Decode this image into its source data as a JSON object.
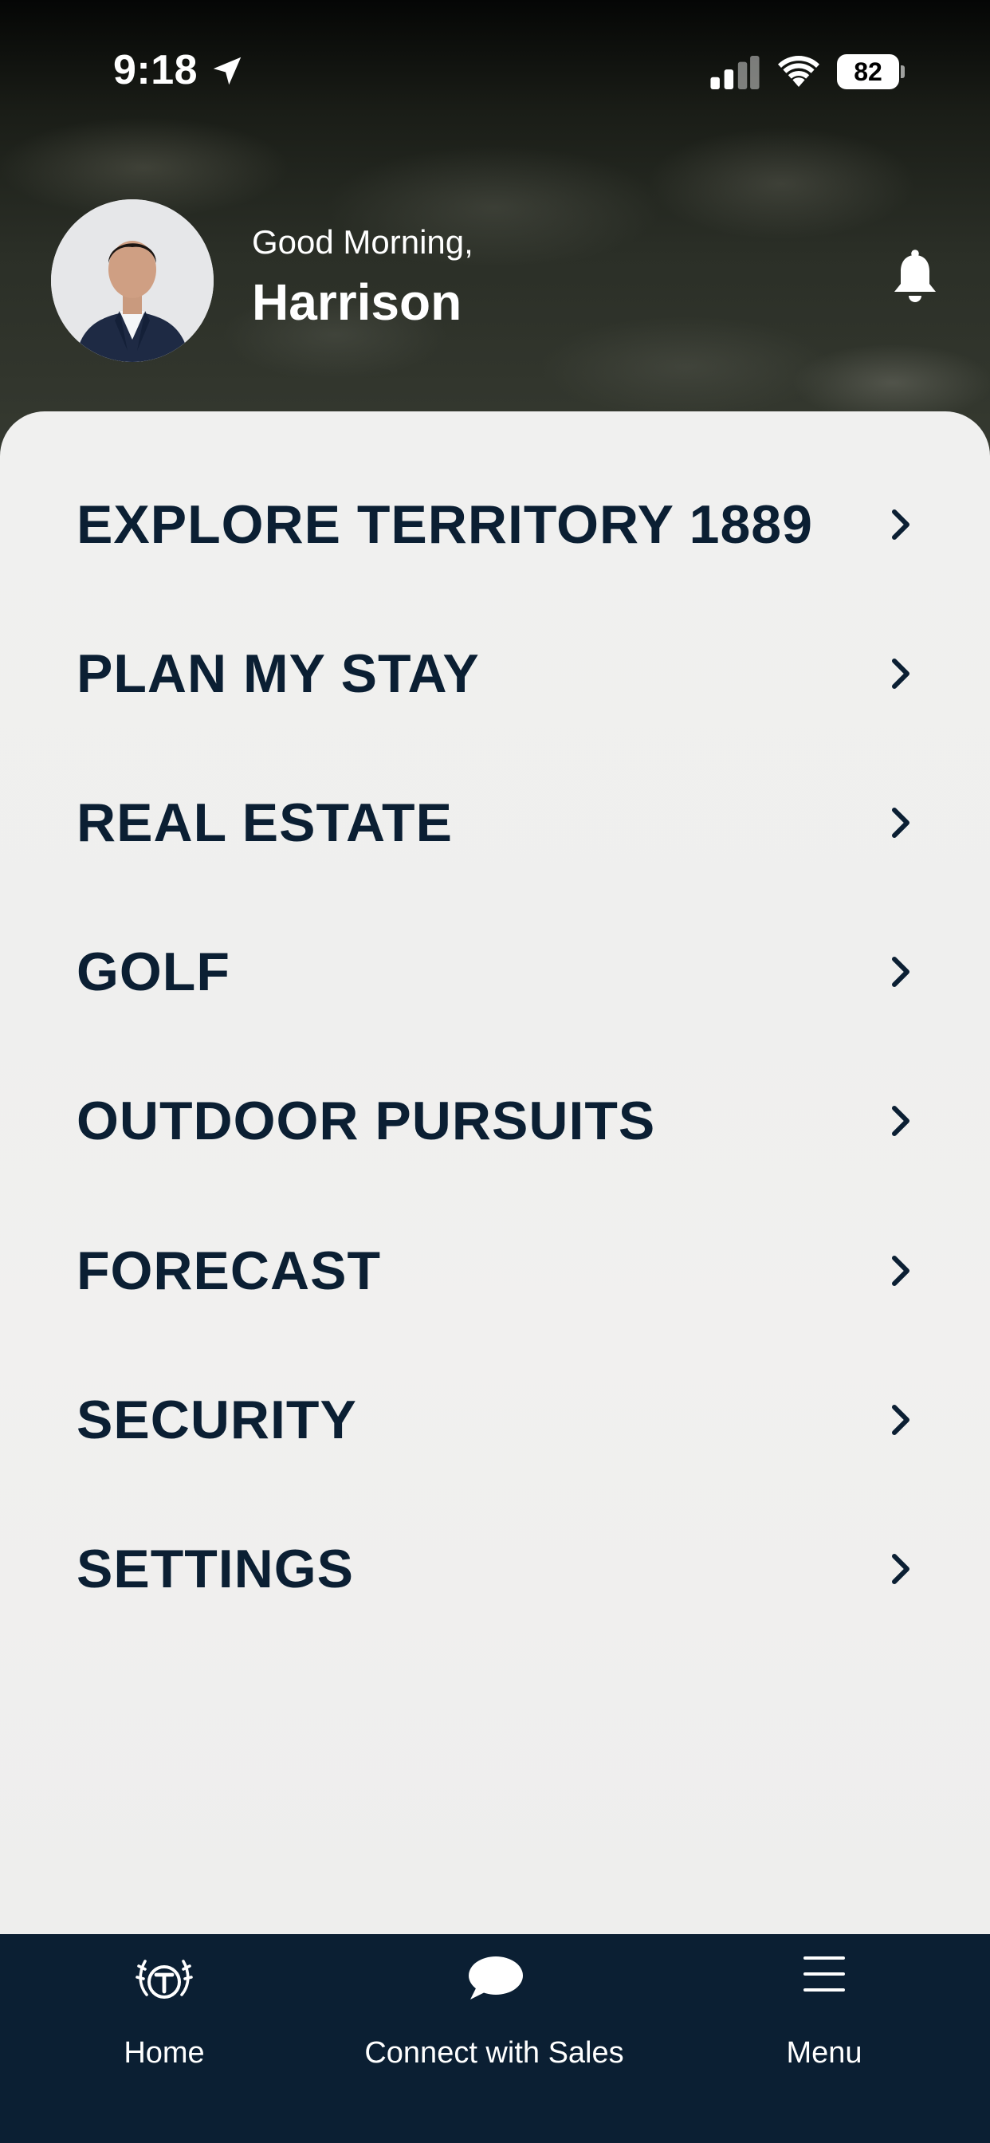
{
  "status_bar": {
    "time": "9:18",
    "battery_level": "82"
  },
  "header": {
    "greeting": "Good Morning,",
    "user_name": "Harrison"
  },
  "menu": {
    "items": [
      {
        "label": "EXPLORE TERRITORY 1889"
      },
      {
        "label": "PLAN MY STAY"
      },
      {
        "label": "REAL ESTATE"
      },
      {
        "label": "GOLF"
      },
      {
        "label": "OUTDOOR PURSUITS"
      },
      {
        "label": "FORECAST"
      },
      {
        "label": "SECURITY"
      },
      {
        "label": "SETTINGS"
      }
    ]
  },
  "tab_bar": {
    "home_label": "Home",
    "sales_label": "Connect with Sales",
    "menu_label": "Menu"
  },
  "colors": {
    "navy": "#0b1f33",
    "card_background": "#f0f0ef",
    "header_text": "#ffffff"
  },
  "icons": {
    "location": "location-arrow-icon",
    "signal": "cellular-signal-icon",
    "wifi": "wifi-icon",
    "bell": "bell-icon",
    "chevron": "chevron-right-icon",
    "home": "antler-t-logo-icon",
    "sales": "chat-bubble-icon",
    "menu": "hamburger-icon"
  }
}
